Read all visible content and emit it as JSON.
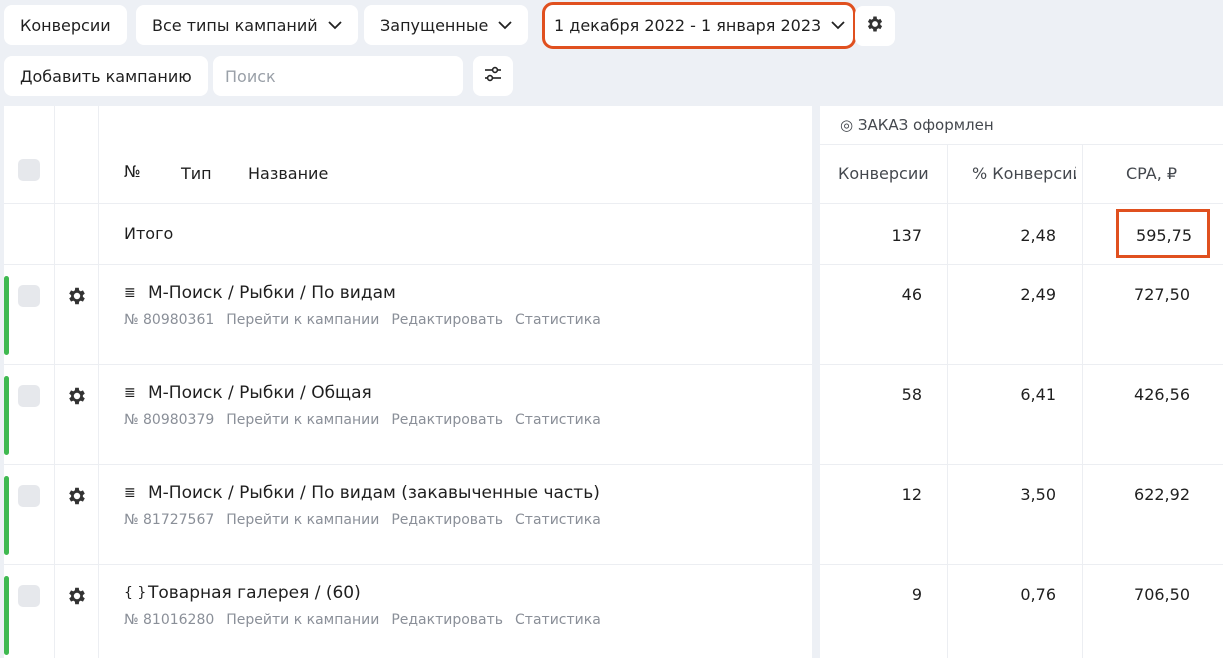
{
  "filters": {
    "conversions": "Конверсии",
    "campaign_types": "Все типы кампаний",
    "status": "Запущенные",
    "date_range": "1 декабря 2022 - 1 января 2023"
  },
  "actions": {
    "add_campaign": "Добавить кампанию",
    "search_placeholder": "Поиск"
  },
  "table": {
    "goal_header": "◎ ЗАКАЗ оформлен",
    "columns": {
      "number": "№",
      "type": "Тип",
      "name": "Название",
      "conversions": "Конверсии",
      "conversion_rate": "% Конверсий",
      "cpa": "CPA, ₽"
    },
    "total": {
      "label": "Итого",
      "conversions": "137",
      "conversion_rate": "2,48",
      "cpa": "595,75"
    },
    "rows": [
      {
        "type_icon": "text-ad-icon",
        "type_glyph": "≣",
        "title": "М-Поиск / Рыбки / По видам",
        "id": "№ 80980361",
        "link_go": "Перейти к кампании",
        "link_edit": "Редактировать",
        "link_stats": "Статистика",
        "conversions": "46",
        "conversion_rate": "2,49",
        "cpa": "727,50"
      },
      {
        "type_icon": "text-ad-icon",
        "type_glyph": "≣",
        "title": "М-Поиск / Рыбки / Общая",
        "id": "№ 80980379",
        "link_go": "Перейти к кампании",
        "link_edit": "Редактировать",
        "link_stats": "Статистика",
        "conversions": "58",
        "conversion_rate": "6,41",
        "cpa": "426,56"
      },
      {
        "type_icon": "text-ad-icon",
        "type_glyph": "≣",
        "title": "М-Поиск / Рыбки / По видам (закавыченные часть)",
        "id": "№ 81727567",
        "link_go": "Перейти к кампании",
        "link_edit": "Редактировать",
        "link_stats": "Статистика",
        "conversions": "12",
        "conversion_rate": "3,50",
        "cpa": "622,92"
      },
      {
        "type_icon": "product-gallery-icon",
        "type_glyph": "{ }",
        "title": "Товарная галерея / (60)",
        "id": "№ 81016280",
        "link_go": "Перейти к кампании",
        "link_edit": "Редактировать",
        "link_stats": "Статистика",
        "conversions": "9",
        "conversion_rate": "0,76",
        "cpa": "706,50"
      }
    ]
  },
  "colors": {
    "highlight": "#e0501f",
    "active_bar": "#3fb950",
    "background": "#edf0f5"
  }
}
